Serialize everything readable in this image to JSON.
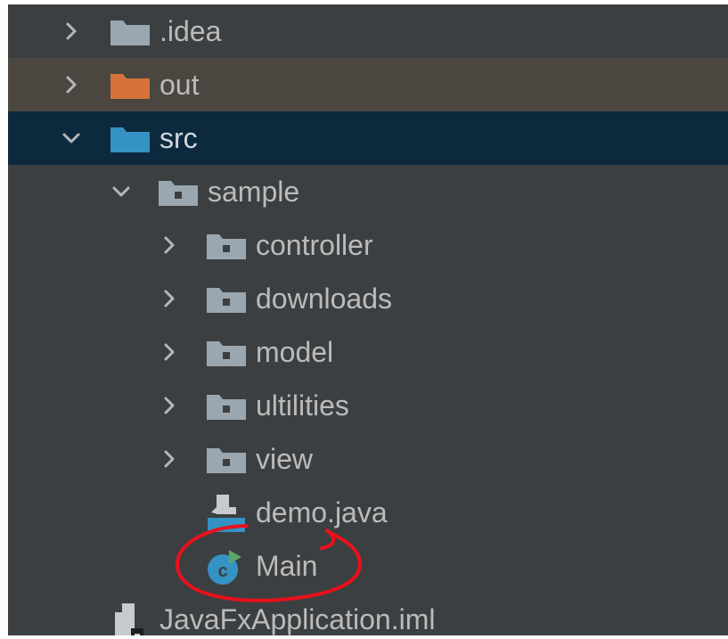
{
  "tree": {
    "items": [
      {
        "name": ".idea",
        "type": "folder",
        "expanded": false,
        "depth": 0
      },
      {
        "name": "out",
        "type": "folder-excluded",
        "expanded": false,
        "depth": 0
      },
      {
        "name": "src",
        "type": "folder-source",
        "expanded": true,
        "depth": 0,
        "selected": true
      },
      {
        "name": "sample",
        "type": "package",
        "expanded": true,
        "depth": 1
      },
      {
        "name": "controller",
        "type": "package",
        "expanded": false,
        "depth": 2
      },
      {
        "name": "downloads",
        "type": "package",
        "expanded": false,
        "depth": 2
      },
      {
        "name": "model",
        "type": "package",
        "expanded": false,
        "depth": 2
      },
      {
        "name": "ultilities",
        "type": "package",
        "expanded": false,
        "depth": 2
      },
      {
        "name": "view",
        "type": "package",
        "expanded": false,
        "depth": 2
      },
      {
        "name": "demo.java",
        "type": "java-file",
        "depth": 2
      },
      {
        "name": "Main",
        "type": "java-class-runnable",
        "depth": 2,
        "annotated": true
      },
      {
        "name": "JavaFxApplication.iml",
        "type": "iml-file",
        "depth": 0
      }
    ]
  },
  "colors": {
    "panel_bg": "#3c3f41",
    "selected_row_bg": "#0d293e",
    "out_row_bg": "#4b4740",
    "text": "#bbbbbb",
    "folder_grey": "#9aa7b0",
    "folder_excluded": "#d5733a",
    "folder_source": "#3592c4",
    "annotation": "#e8111b"
  }
}
